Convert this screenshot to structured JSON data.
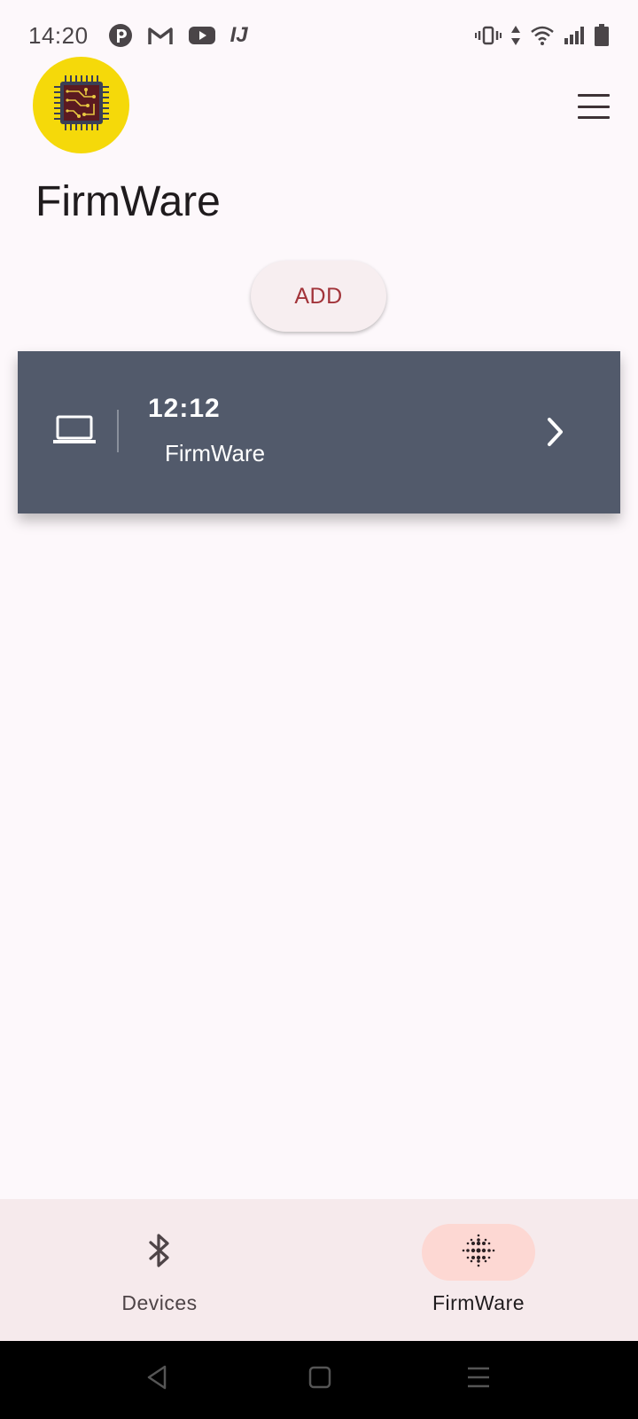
{
  "status_bar": {
    "time": "14:20",
    "left_icons": [
      "podcast-icon",
      "gmail-icon",
      "youtube-icon",
      "ij-icon"
    ],
    "right_icons": [
      "vibrate-icon",
      "data-arrows-icon",
      "wifi-icon",
      "signal-icon",
      "battery-icon"
    ],
    "ij_text": "IJ"
  },
  "header": {
    "logo_icon": "chip-icon",
    "menu_icon": "hamburger-menu-icon",
    "title": "FirmWare"
  },
  "actions": {
    "add_label": "ADD"
  },
  "firmware_list": [
    {
      "icon": "laptop-icon",
      "time": "12:12",
      "name": "FirmWare",
      "action_icon": "chevron-right-icon"
    }
  ],
  "bottom_nav": {
    "items": [
      {
        "label": "Devices",
        "icon": "bluetooth-icon",
        "active": false
      },
      {
        "label": "FirmWare",
        "icon": "dots-grid-icon",
        "active": true
      }
    ]
  },
  "colors": {
    "background": "#fdf8fb",
    "logo_bg": "#f5d90a",
    "chip": "#5b1a20",
    "card": "#525a6b",
    "accent_text": "#a2343a",
    "nav_bg": "#f6eaec",
    "nav_active": "#fdd8d3"
  }
}
